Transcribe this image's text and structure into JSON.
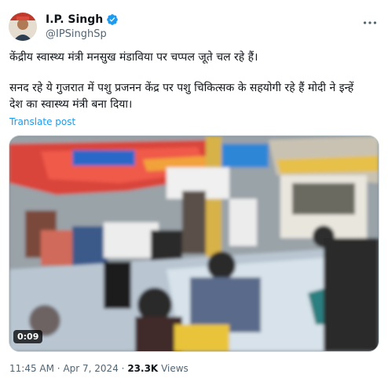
{
  "author": {
    "name": "I.P. Singh",
    "handle": "@IPSinghSp",
    "verified": true,
    "verified_color": "#1d9bf0"
  },
  "icons": {
    "verified": "verified-badge-icon",
    "more": "more-options-icon",
    "play": "video-icon"
  },
  "tweet": {
    "line1": "केंद्रीय स्वास्थ्य मंत्री मनसुख मंडाविया पर चप्पल जूते चल रहे हैं।",
    "line2": "सनद रहे ये गुजरात में पशु प्रजनन केंद्र पर पशु चिकित्सक के सहयोगी रहे हैं मोदी ने इन्हें",
    "line3": "देश का स्वास्थ्य मंत्री बना दिया।",
    "translate_label": "Translate post"
  },
  "media": {
    "type": "video",
    "duration": "0:09"
  },
  "meta": {
    "time": "11:45 AM",
    "separator": "·",
    "date": "Apr 7, 2024",
    "views_count": "23.3K",
    "views_label": "Views"
  },
  "colors": {
    "text": "#0f1419",
    "secondary": "#536471",
    "link": "#1d9bf0"
  }
}
